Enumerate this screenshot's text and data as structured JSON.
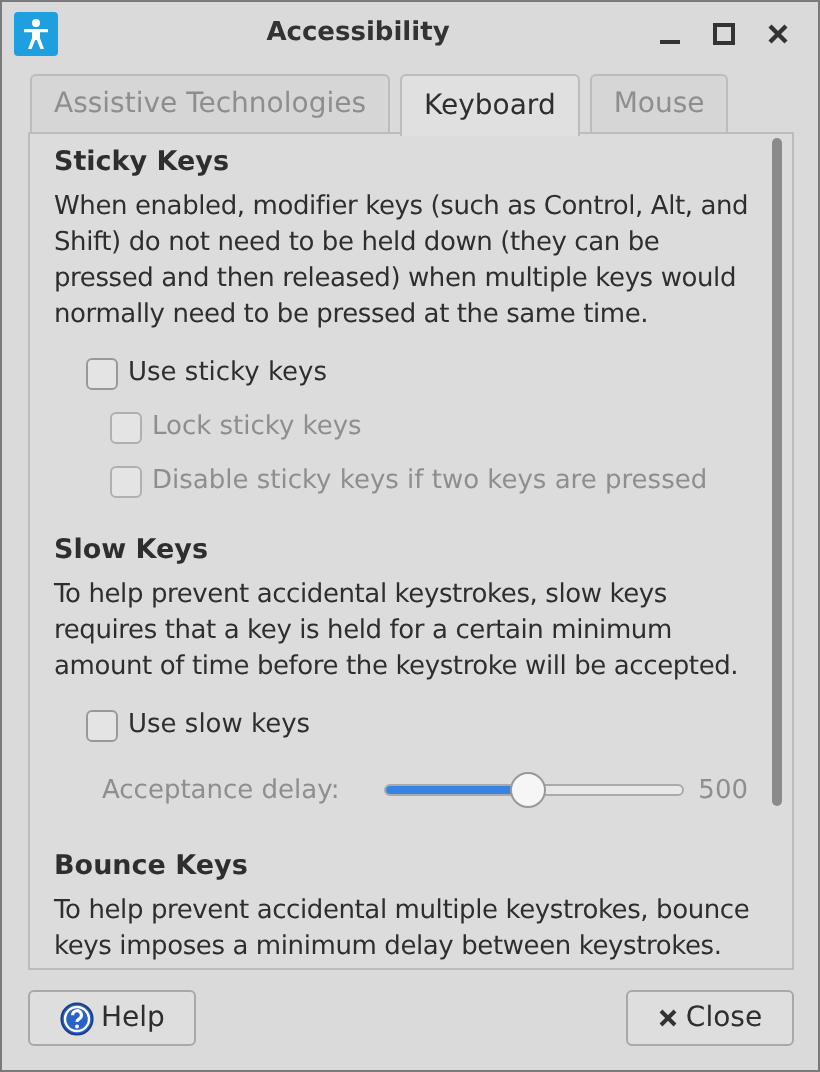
{
  "window": {
    "title": "Accessibility"
  },
  "tabs": [
    {
      "label": "Assistive Technologies",
      "selected": false,
      "disabled": true
    },
    {
      "label": "Keyboard",
      "selected": true,
      "disabled": false
    },
    {
      "label": "Mouse",
      "selected": false,
      "disabled": true
    }
  ],
  "sections": [
    {
      "title": "Sticky Keys",
      "description": "When enabled, modifier keys (such as Control, Alt, and Shift) do not need to be held down (they can be pressed and then released) when multiple keys would normally need to be pressed at the same time.",
      "items": [
        {
          "kind": "checkbox",
          "label": "Use sticky keys",
          "checked": false,
          "disabled": false,
          "children": [
            {
              "kind": "checkbox",
              "label": "Lock sticky keys",
              "checked": false,
              "disabled": true
            },
            {
              "kind": "checkbox",
              "label": "Disable sticky keys if two keys are pressed",
              "checked": false,
              "disabled": true
            }
          ]
        }
      ]
    },
    {
      "title": "Slow Keys",
      "description": "To help prevent accidental keystrokes, slow keys requires that a key is held for a certain minimum amount of time before the keystroke will be accepted.",
      "items": [
        {
          "kind": "checkbox",
          "label": "Use slow keys",
          "checked": false,
          "disabled": false
        },
        {
          "kind": "slider",
          "label": "Acceptance delay:",
          "level": 0.48,
          "reading": "500",
          "disabled": true
        }
      ]
    },
    {
      "title": "Bounce Keys",
      "description": "To help prevent accidental multiple keystrokes, bounce keys imposes a minimum delay between keystrokes."
    }
  ],
  "buttons": [
    {
      "kind": "help",
      "label": "Help"
    },
    {
      "kind": "close",
      "label": "Close"
    }
  ]
}
